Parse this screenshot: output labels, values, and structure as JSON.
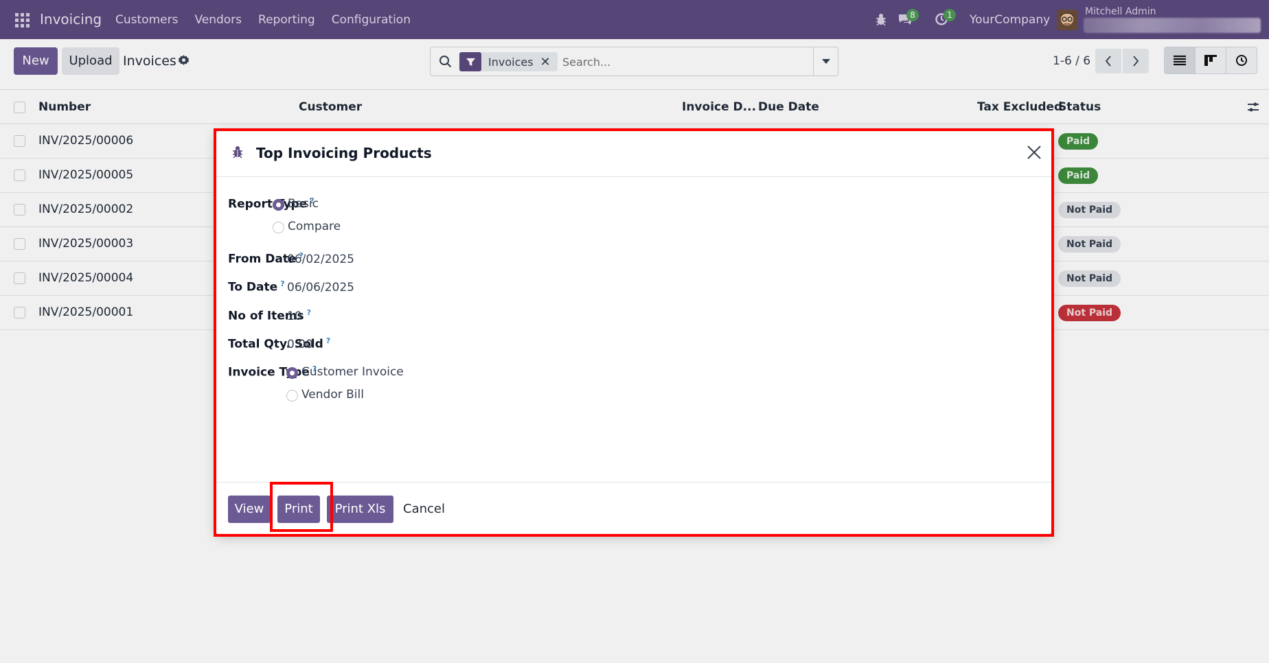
{
  "navbar": {
    "app_name": "Invoicing",
    "menu": [
      "Customers",
      "Vendors",
      "Reporting",
      "Configuration"
    ],
    "chat_count": "8",
    "activity_count": "1",
    "company": "YourCompany",
    "user": "Mitchell Admin"
  },
  "control": {
    "new_label": "New",
    "upload_label": "Upload",
    "title": "Invoices",
    "facet_label": "Invoices",
    "facet_close": "✕",
    "search_placeholder": "Search...",
    "pager": "1-6 / 6"
  },
  "list": {
    "columns": [
      "Number",
      "Customer",
      "Invoice D...",
      "Due Date",
      "Tax Excluded",
      "Status"
    ],
    "rows": [
      {
        "number": "INV/2025/00006",
        "status": "Paid",
        "status_kind": "paid"
      },
      {
        "number": "INV/2025/00005",
        "status": "Paid",
        "status_kind": "paid"
      },
      {
        "number": "INV/2025/00002",
        "status": "Not Paid",
        "status_kind": "notpaid"
      },
      {
        "number": "INV/2025/00003",
        "status": "Not Paid",
        "status_kind": "notpaid"
      },
      {
        "number": "INV/2025/00004",
        "status": "Not Paid",
        "status_kind": "notpaid"
      },
      {
        "number": "INV/2025/00001",
        "status": "Not Paid",
        "status_kind": "notpaid-red"
      }
    ]
  },
  "modal": {
    "title": "Top Invoicing Products",
    "report_type": {
      "label": "Report Type",
      "help": "?",
      "options": [
        "Basic",
        "Compare"
      ],
      "selected": "Basic"
    },
    "from_date": {
      "label": "From Date",
      "help": "?",
      "value": "06/02/2025"
    },
    "to_date": {
      "label": "To Date",
      "help": "?",
      "value": "06/06/2025"
    },
    "no_items": {
      "label": "No of Items",
      "help": "?",
      "value": "10"
    },
    "total_qty": {
      "label": "Total Qty. Sold",
      "help": "?",
      "value": "0.00"
    },
    "invoice_type": {
      "label": "Invoice Type",
      "help": "?",
      "options": [
        "Customer Invoice",
        "Vendor Bill"
      ],
      "selected": "Customer Invoice"
    },
    "buttons": {
      "view": "View",
      "print": "Print",
      "print_xls": "Print Xls",
      "cancel": "Cancel"
    }
  },
  "colors": {
    "navbar": "#5c4a7f",
    "primary": "#6c5a94",
    "highlight": "#ff0000",
    "paid": "#3f8f3e",
    "not_paid_overdue": "#c5343c"
  }
}
